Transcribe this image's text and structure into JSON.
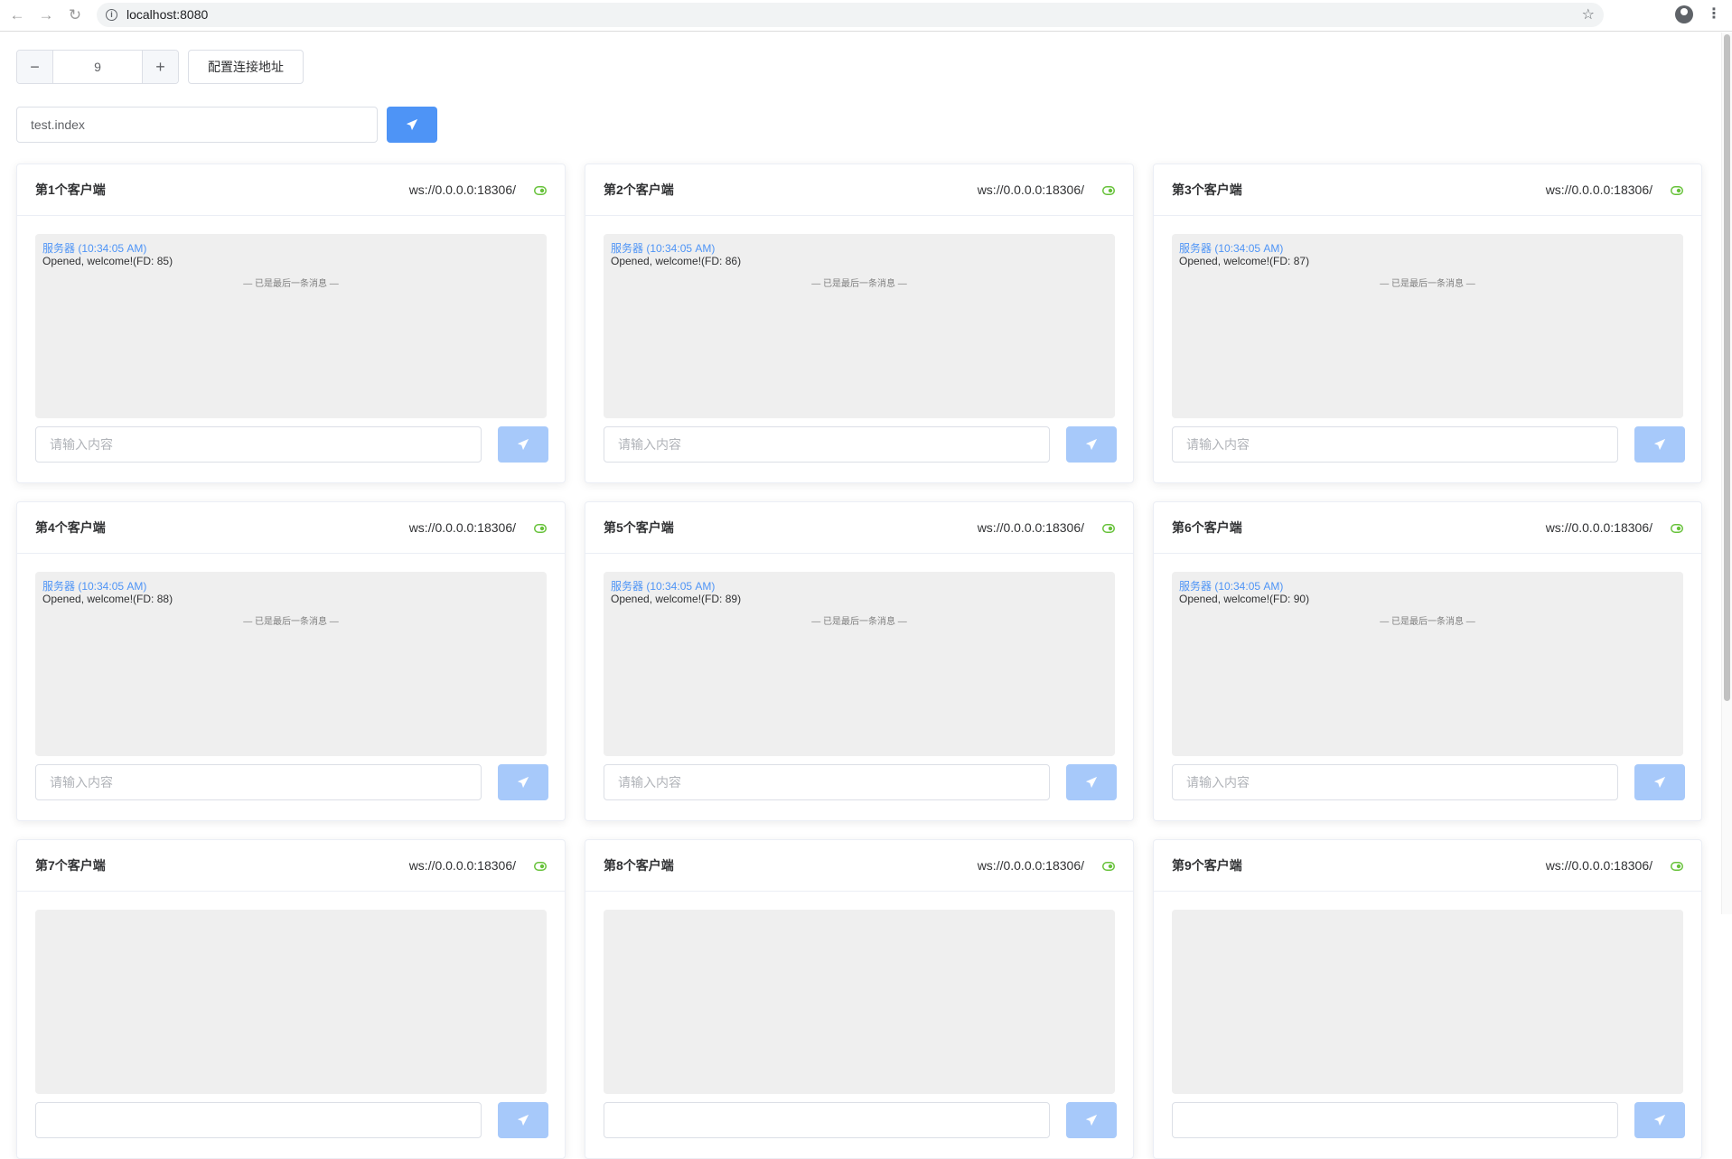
{
  "browser": {
    "url": "localhost:8080"
  },
  "controls": {
    "count_value": "9",
    "minus_label": "−",
    "plus_label": "+",
    "config_label": "配置连接地址",
    "route_value": "test.index"
  },
  "colors": {
    "primary": "#4e94f6",
    "primary_disabled": "#a7c9fa",
    "connected": "#67c23a"
  },
  "clients": [
    {
      "title": "第1个客户端",
      "url": "ws://0.0.0.0:18306/",
      "sender": "服务器 (10:34:05 AM)",
      "message": "Opened, welcome!(FD: 85)",
      "end_note": "— 已是最后一条消息 —",
      "placeholder": "请输入内容"
    },
    {
      "title": "第2个客户端",
      "url": "ws://0.0.0.0:18306/",
      "sender": "服务器 (10:34:05 AM)",
      "message": "Opened, welcome!(FD: 86)",
      "end_note": "— 已是最后一条消息 —",
      "placeholder": "请输入内容"
    },
    {
      "title": "第3个客户端",
      "url": "ws://0.0.0.0:18306/",
      "sender": "服务器 (10:34:05 AM)",
      "message": "Opened, welcome!(FD: 87)",
      "end_note": "— 已是最后一条消息 —",
      "placeholder": "请输入内容"
    },
    {
      "title": "第4个客户端",
      "url": "ws://0.0.0.0:18306/",
      "sender": "服务器 (10:34:05 AM)",
      "message": "Opened, welcome!(FD: 88)",
      "end_note": "— 已是最后一条消息 —",
      "placeholder": "请输入内容"
    },
    {
      "title": "第5个客户端",
      "url": "ws://0.0.0.0:18306/",
      "sender": "服务器 (10:34:05 AM)",
      "message": "Opened, welcome!(FD: 89)",
      "end_note": "— 已是最后一条消息 —",
      "placeholder": "请输入内容"
    },
    {
      "title": "第6个客户端",
      "url": "ws://0.0.0.0:18306/",
      "sender": "服务器 (10:34:05 AM)",
      "message": "Opened, welcome!(FD: 90)",
      "end_note": "— 已是最后一条消息 —",
      "placeholder": "请输入内容"
    },
    {
      "title": "第7个客户端",
      "url": "ws://0.0.0.0:18306/"
    },
    {
      "title": "第8个客户端",
      "url": "ws://0.0.0.0:18306/"
    },
    {
      "title": "第9个客户端",
      "url": "ws://0.0.0.0:18306/"
    }
  ]
}
